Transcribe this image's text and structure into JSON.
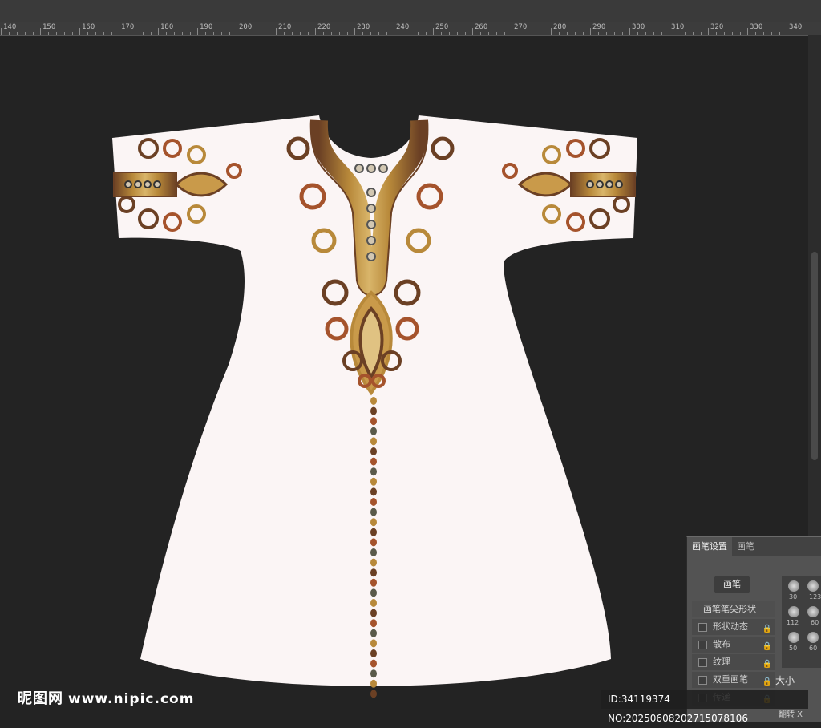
{
  "ruler": {
    "labels": [
      "140",
      "150",
      "160",
      "170",
      "180",
      "190",
      "200",
      "210",
      "220",
      "230",
      "240",
      "250",
      "260",
      "270",
      "280",
      "290",
      "300",
      "310",
      "320",
      "330",
      "340"
    ]
  },
  "panel": {
    "tab_brush_settings": "画笔设置",
    "tab_brushes": "画笔",
    "brush_button": "画笔",
    "tip_shape_header": "画笔笔尖形状",
    "options": [
      "形状动态",
      "散布",
      "纹理",
      "双重画笔",
      "传递"
    ],
    "preset_sizes": [
      "30",
      "123",
      "112",
      "60",
      "50",
      "60"
    ],
    "size_label": "大小",
    "flip_label": "翻转 X"
  },
  "watermark": {
    "brand": "昵图网",
    "url": "www.nipic.com",
    "id_text": "ID:34119374 NO:20250608202715078106"
  },
  "colors": {
    "canvas_bg": "#232323",
    "garment": "#fbf5f5",
    "embroidery_gold": "#b8893a",
    "embroidery_brown": "#6b4024",
    "embroidery_copper": "#a5532c"
  }
}
